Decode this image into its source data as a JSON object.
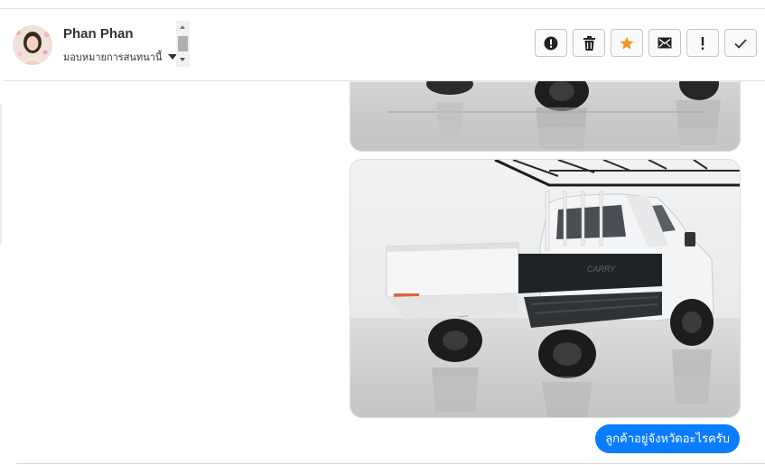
{
  "header": {
    "contact_name": "Phan Phan",
    "assign_label": "มอบหมายการสนทนานี้"
  },
  "actions": [
    {
      "icon": "alert-circle-icon"
    },
    {
      "icon": "trash-icon"
    },
    {
      "icon": "star-icon",
      "color": "#f7931e"
    },
    {
      "icon": "envelope-icon"
    },
    {
      "icon": "exclamation-icon"
    },
    {
      "icon": "checkmark-icon"
    }
  ],
  "messages": [
    {
      "type": "image",
      "content": "white pickup truck rear wheels (cropped top)"
    },
    {
      "type": "image",
      "content": "white pickup truck rear view in showroom"
    },
    {
      "type": "text",
      "text": "ลูกค้าอยู่จังหวัดอะไรครับ"
    }
  ],
  "colors": {
    "accent": "#0a7cff",
    "star": "#f7931e"
  }
}
